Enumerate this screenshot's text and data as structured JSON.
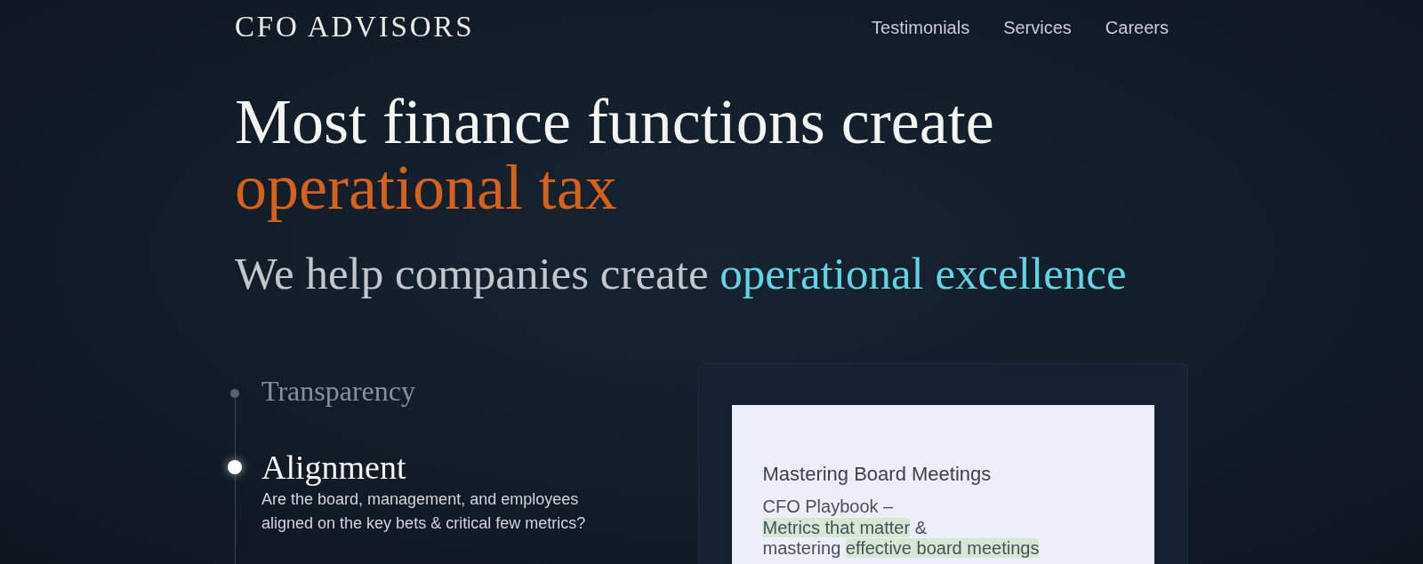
{
  "header": {
    "logo": "CFO ADVISORS",
    "nav": [
      "Testimonials",
      "Services",
      "Careers"
    ]
  },
  "hero": {
    "headline": [
      {
        "text": "Most finance functions create",
        "accent": false
      },
      {
        "text": "operational tax",
        "accent": true
      }
    ],
    "subheadline": [
      {
        "text": "We help companies create ",
        "accent": false
      },
      {
        "text": "operational excellence",
        "accent": true
      }
    ]
  },
  "pillars": [
    {
      "title": "Transparency",
      "selected": false
    },
    {
      "title": "Alignment",
      "selected": true,
      "description": "Are the board, management, and employees aligned on the key bets & critical few metrics?"
    }
  ],
  "feature_card": {
    "title": "Mastering Board Meetings",
    "lines": [
      [
        {
          "text": "CFO Playbook –",
          "highlighted": false
        }
      ],
      [
        {
          "text": "Metrics that matter",
          "highlighted": true
        },
        {
          "text": " &",
          "highlighted": false
        }
      ],
      [
        {
          "text": "mastering ",
          "highlighted": false
        },
        {
          "text": "effective board meetings",
          "highlighted": true
        }
      ]
    ]
  }
}
